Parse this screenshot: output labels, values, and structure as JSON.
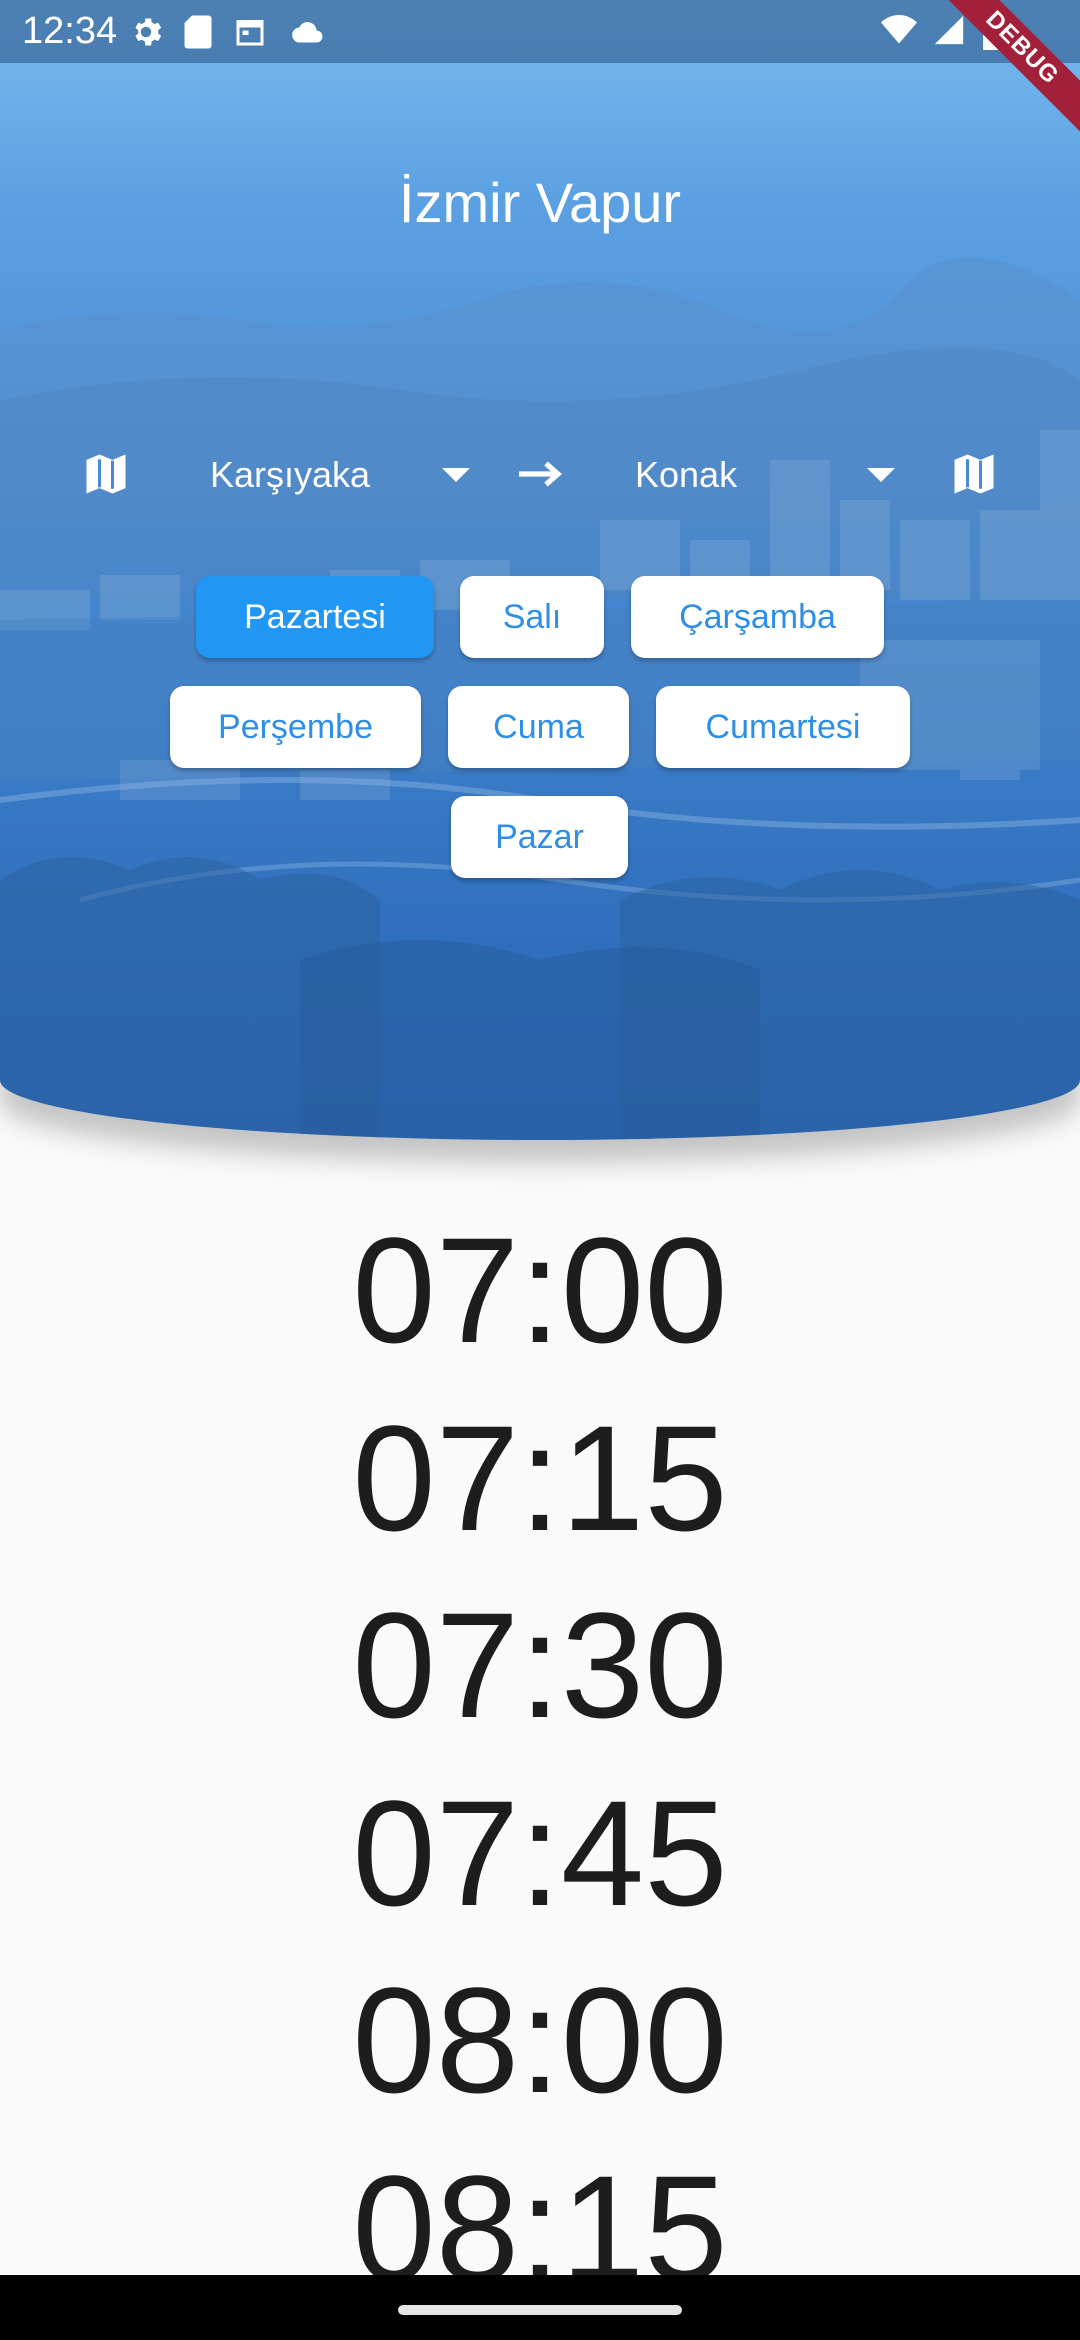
{
  "status_bar": {
    "time": "12:34",
    "left_icons": [
      "settings-icon",
      "sd-card-icon",
      "calendar-icon",
      "cloud-icon"
    ],
    "right_icons": [
      "wifi-icon",
      "signal-icon",
      "battery-icon"
    ]
  },
  "debug_banner": "DEBUG",
  "app": {
    "title": "İzmir Vapur"
  },
  "route": {
    "from_value": "Karşıyaka",
    "to_value": "Konak",
    "from_icon": "map-icon",
    "to_icon": "map-icon",
    "arrow_icon": "arrow-right-icon"
  },
  "days": [
    {
      "label": "Pazartesi",
      "selected": true
    },
    {
      "label": "Salı",
      "selected": false
    },
    {
      "label": "Çarşamba",
      "selected": false
    },
    {
      "label": "Perşembe",
      "selected": false
    },
    {
      "label": "Cuma",
      "selected": false
    },
    {
      "label": "Cumartesi",
      "selected": false
    },
    {
      "label": "Pazar",
      "selected": false
    }
  ],
  "times": [
    "07:00",
    "07:15",
    "07:30",
    "07:45",
    "08:00",
    "08:15"
  ],
  "colors": {
    "accent": "#2196f3",
    "chip_text": "#2f8fe8",
    "header_top": "#7bbcf0",
    "header_bottom": "#2a66b6",
    "debug_ribbon": "#a3203a"
  }
}
